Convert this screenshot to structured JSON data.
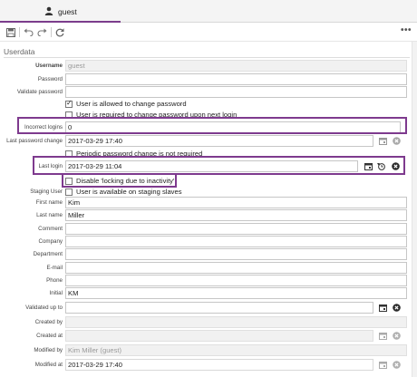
{
  "tab": {
    "label": "guest"
  },
  "section": {
    "title": "Userdata"
  },
  "fields": {
    "username": {
      "label": "Username",
      "value": "guest"
    },
    "password": {
      "label": "Password",
      "value": ""
    },
    "validate_password": {
      "label": "Validate password",
      "value": ""
    },
    "incorrect_logins": {
      "label": "Incorrect logins",
      "value": "0"
    },
    "last_password_change": {
      "label": "Last password change",
      "value": "2017-03-29 17:40"
    },
    "last_login": {
      "label": "Last login",
      "value": "2017-03-29 11:04"
    },
    "staging_user": {
      "label": "Staging User"
    },
    "first_name": {
      "label": "First name",
      "value": "Kim"
    },
    "last_name": {
      "label": "Last name",
      "value": "Miller"
    },
    "comment": {
      "label": "Comment",
      "value": ""
    },
    "company": {
      "label": "Company",
      "value": ""
    },
    "department": {
      "label": "Department",
      "value": ""
    },
    "email": {
      "label": "E-mail",
      "value": ""
    },
    "phone": {
      "label": "Phone",
      "value": ""
    },
    "initial": {
      "label": "Initial",
      "value": "KM"
    },
    "validated_up_to": {
      "label": "Validated up to",
      "value": ""
    },
    "created_by": {
      "label": "Created by",
      "value": ""
    },
    "created_at": {
      "label": "Created at",
      "value": ""
    },
    "modified_by": {
      "label": "Modified by",
      "value": "Kim Miller (guest)"
    },
    "modified_at": {
      "label": "Modified at",
      "value": "2017-03-29 17:40"
    }
  },
  "checkboxes": {
    "allowed_change_password": {
      "label": "User is allowed to change password",
      "checked": true
    },
    "required_change_password": {
      "label": "User is required to change password upon next login",
      "checked": false
    },
    "periodic_not_required": {
      "label": "Periodic password change is not required",
      "checked": false
    },
    "disable_locking": {
      "label": "Disable 'locking due to inactivity'",
      "checked": false
    },
    "available_on_staging": {
      "label": "User is available on staging slaves",
      "checked": false
    }
  },
  "colors": {
    "accent": "#7b3c8c",
    "highlight": "#7e3a8e"
  }
}
